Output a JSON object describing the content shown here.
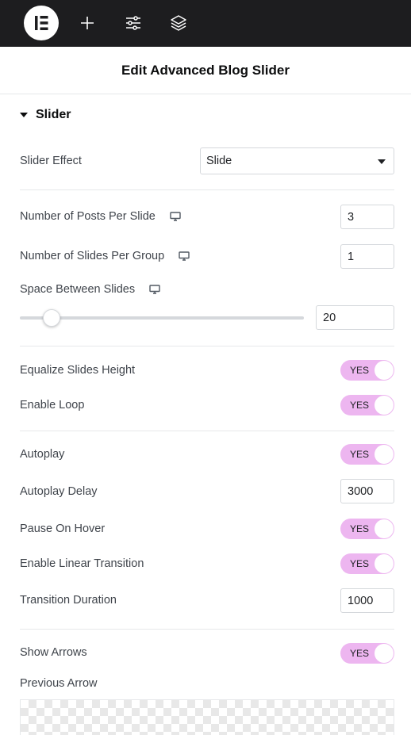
{
  "topbar": {
    "logo_icon": "elementor-logo-icon",
    "icons": [
      "add-icon",
      "settings-sliders-icon",
      "layers-icon"
    ]
  },
  "header": {
    "title": "Edit Advanced Blog Slider"
  },
  "section": {
    "title": "Slider"
  },
  "fields": {
    "slider_effect": {
      "label": "Slider Effect",
      "value": "Slide"
    },
    "posts_per_slide": {
      "label": "Number of Posts Per Slide",
      "value": "3"
    },
    "slides_per_group": {
      "label": "Number of Slides Per Group",
      "value": "1"
    },
    "space_between": {
      "label": "Space Between Slides",
      "value": "20"
    },
    "equalize_height": {
      "label": "Equalize Slides Height",
      "toggle": "YES"
    },
    "enable_loop": {
      "label": "Enable Loop",
      "toggle": "YES"
    },
    "autoplay": {
      "label": "Autoplay",
      "toggle": "YES"
    },
    "autoplay_delay": {
      "label": "Autoplay Delay",
      "value": "3000"
    },
    "pause_on_hover": {
      "label": "Pause On Hover",
      "toggle": "YES"
    },
    "linear_transition": {
      "label": "Enable Linear Transition",
      "toggle": "YES"
    },
    "transition_duration": {
      "label": "Transition Duration",
      "value": "1000"
    },
    "show_arrows": {
      "label": "Show Arrows",
      "toggle": "YES"
    },
    "previous_arrow": {
      "label": "Previous Arrow"
    }
  },
  "colors": {
    "toggle_on": "#edb6f0",
    "topbar": "#1d1d1f"
  }
}
